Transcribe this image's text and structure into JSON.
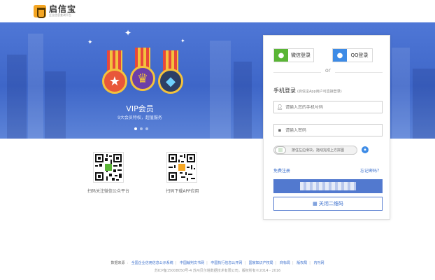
{
  "header": {
    "logo_title": "启信宝",
    "logo_sub": "企业信息查询平台"
  },
  "banner": {
    "vip_title": "VIP会员",
    "vip_subtitle": "9大会员特权，超值服务"
  },
  "qr": [
    {
      "label": "扫码关注微信公众平台"
    },
    {
      "label": "扫码下载APP应用"
    }
  ],
  "login": {
    "wechat_label": "微信登录",
    "qq_label": "QQ登录",
    "or_text": "or",
    "title": "手机登录",
    "title_note": "(启信宝App用户可直接登录)",
    "phone_placeholder": "请输入您的手机号码",
    "password_placeholder": "请输入密码",
    "slider_hint": "按住左边滑块，拖动完成上方拼图",
    "register_link": "免费注册",
    "forgot_link": "忘记密码？",
    "close_qr_label": "关闭二维码"
  },
  "footer": {
    "source_label": "数据来源",
    "links": [
      "全国企业信用信息公示系统",
      "中国裁判文书网",
      "中国执行信息公开网",
      "国家知识产权局",
      "商标局",
      "版权局",
      "内刊网"
    ],
    "copyright": "苏ICP备15008050号-4 苏州贝尔塔数据技术有限公司，版权所有©2014 - 2016"
  },
  "colors": {
    "brand_blue": "#5279cf",
    "link_blue": "#3b6fcc",
    "wechat_green": "#5ab536",
    "qq_blue": "#3d8be6"
  }
}
